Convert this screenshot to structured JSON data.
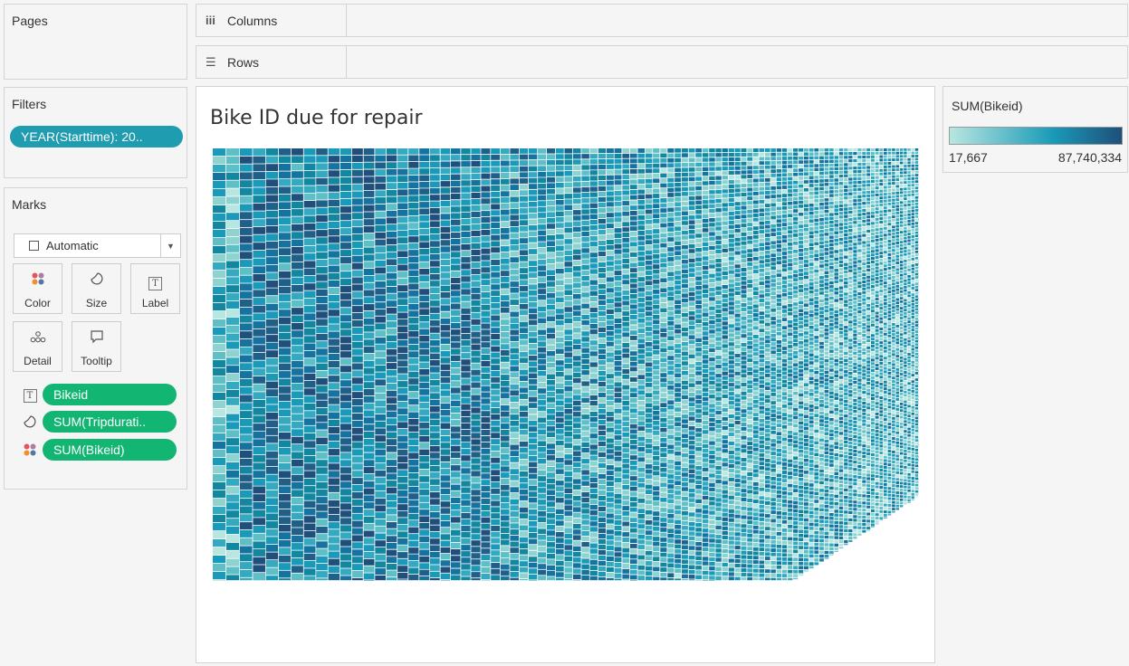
{
  "cards": {
    "pages_title": "Pages",
    "filters_title": "Filters",
    "filter_pill": "YEAR(Starttime): 20..",
    "marks_title": "Marks",
    "mark_type": "Automatic",
    "mark_buttons": {
      "color": "Color",
      "size": "Size",
      "label": "Label",
      "detail": "Detail",
      "tooltip": "Tooltip"
    },
    "encodings": {
      "label_field": "Bikeid",
      "size_field": "SUM(Tripdurati..",
      "color_field": "SUM(Bikeid)"
    }
  },
  "shelves": {
    "columns": "Columns",
    "rows": "Rows"
  },
  "view": {
    "title": "Bike ID due for repair"
  },
  "legend": {
    "title": "SUM(Bikeid)",
    "min": "17,667",
    "max": "87,740,334",
    "colors": [
      "#b8e6e0",
      "#1a9ab8",
      "#1f4f7a"
    ]
  },
  "icons": {
    "columns": "columns-icon",
    "rows": "rows-icon",
    "dropdown": "chevron-down-icon",
    "color": "color-dots-icon",
    "size": "size-icon",
    "label": "text-label-icon",
    "detail": "detail-dots-icon",
    "tooltip": "tooltip-icon"
  },
  "chart_data": {
    "type": "treemap",
    "title": "Bike ID due for repair",
    "size_measure": "SUM(Tripdurati..",
    "color_measure": "SUM(Bikeid)",
    "label_field": "Bikeid",
    "color_range": [
      "17,667",
      "87,740,334"
    ]
  }
}
